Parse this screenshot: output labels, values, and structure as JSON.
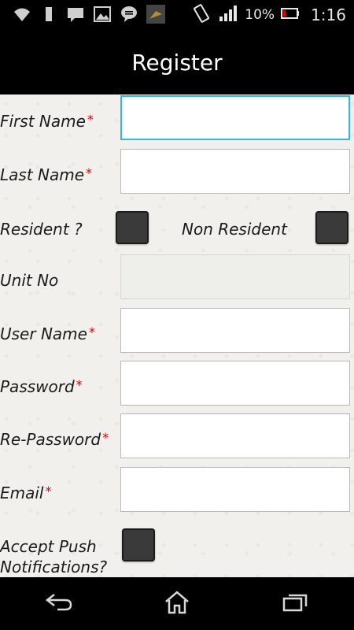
{
  "statusbar": {
    "battery_percent": "10%",
    "time": "1:16",
    "icons": [
      "wifi-icon",
      "usb-icon",
      "sms-icon",
      "image-icon",
      "chat-icon",
      "app-icon",
      "vibrate-icon",
      "signal-icon",
      "battery-icon"
    ]
  },
  "actionbar": {
    "title": "Register"
  },
  "form": {
    "first_name": {
      "label": "First Name",
      "required": "*",
      "value": ""
    },
    "last_name": {
      "label": "Last Name",
      "required": "*",
      "value": ""
    },
    "resident_label": "Resident ?",
    "non_resident_label": "Non Resident",
    "unit_no": {
      "label": "Unit No",
      "value": ""
    },
    "user_name": {
      "label": "User Name",
      "required": "*",
      "value": ""
    },
    "password": {
      "label": "Password",
      "required": "*",
      "value": ""
    },
    "re_password": {
      "label": "Re-Password",
      "required": "*",
      "value": ""
    },
    "email": {
      "label": "Email",
      "required": "*",
      "value": ""
    },
    "push_label_line1": "Accept Push",
    "push_label_line2": "Notifications?"
  },
  "navbar": {
    "buttons": [
      "back-icon",
      "home-icon",
      "recent-apps-icon"
    ]
  },
  "colors": {
    "accent": "#33b5e5",
    "required": "#e00000"
  }
}
